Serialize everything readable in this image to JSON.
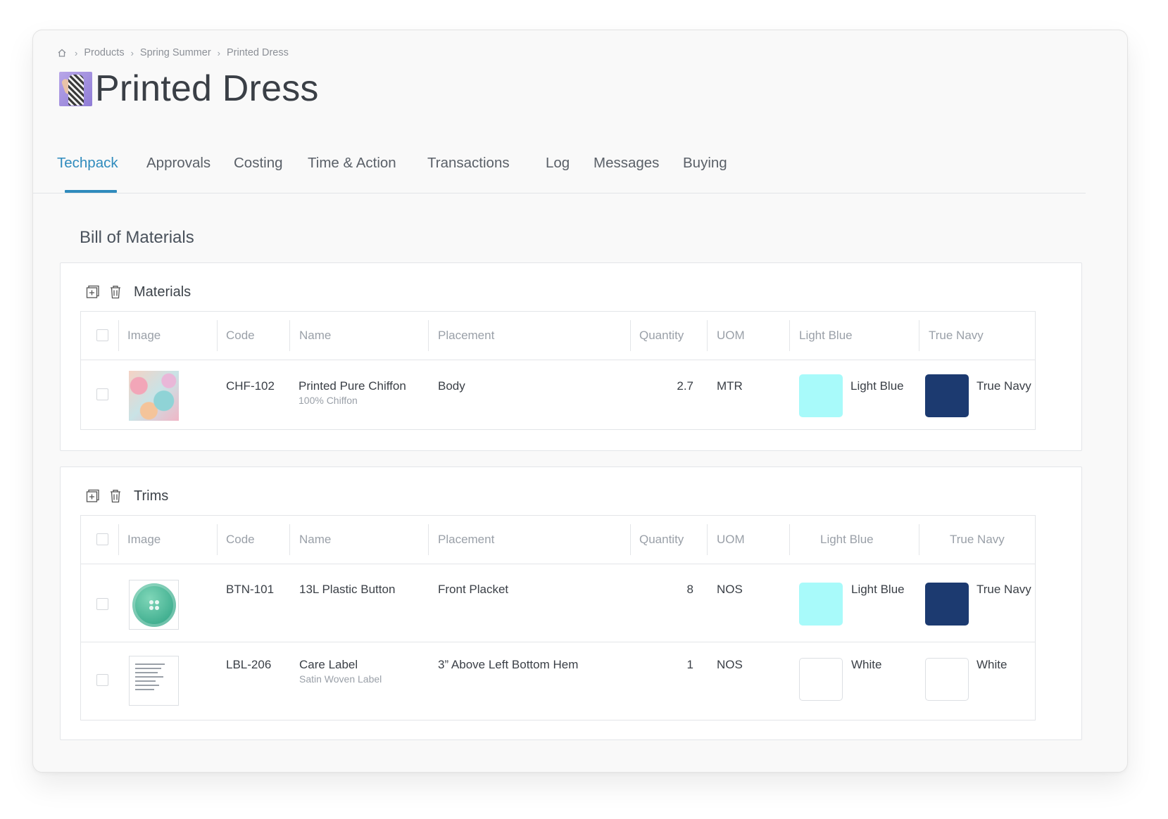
{
  "breadcrumb": {
    "home_icon": "home-icon",
    "items": [
      "Products",
      "Spring Summer",
      "Printed Dress"
    ]
  },
  "page": {
    "title": "Printed Dress"
  },
  "tabs": [
    {
      "label": "Techpack",
      "active": true
    },
    {
      "label": "Approvals"
    },
    {
      "label": "Costing"
    },
    {
      "label": "Time & Action"
    },
    {
      "label": "Transactions"
    },
    {
      "label": "Log"
    },
    {
      "label": "Messages"
    },
    {
      "label": "Buying"
    }
  ],
  "bom": {
    "title": "Bill of Materials",
    "columns": [
      "Image",
      "Code",
      "Name",
      "Placement",
      "Quantity",
      "UOM",
      "Light Blue",
      "True Navy"
    ],
    "materials": {
      "title": "Materials",
      "rows": [
        {
          "code": "CHF-102",
          "name": "Printed Pure Chiffon",
          "subname": "100% Chiffon",
          "placement": "Body",
          "quantity": "2.7",
          "uom": "MTR",
          "color1": {
            "label": "Light Blue",
            "hex": "#a8fafa"
          },
          "color2": {
            "label": "True Navy",
            "hex": "#1c3a70"
          }
        }
      ]
    },
    "trims": {
      "title": "Trims",
      "rows": [
        {
          "code": "BTN-101",
          "name": "13L Plastic Button",
          "subname": "",
          "placement": "Front Placket",
          "quantity": "8",
          "uom": "NOS",
          "color1": {
            "label": "Light Blue",
            "hex": "#a8fafa"
          },
          "color2": {
            "label": "True Navy",
            "hex": "#1c3a70"
          }
        },
        {
          "code": "LBL-206",
          "name": "Care Label",
          "subname": "Satin Woven Label",
          "placement": "3” Above Left Bottom Hem",
          "quantity": "1",
          "uom": "NOS",
          "color1": {
            "label": "White",
            "hex": "#ffffff"
          },
          "color2": {
            "label": "White",
            "hex": "#ffffff"
          }
        }
      ]
    }
  },
  "colors": {
    "accent": "#2f8bbd",
    "light_blue": "#a8fafa",
    "true_navy": "#1c3a70"
  }
}
